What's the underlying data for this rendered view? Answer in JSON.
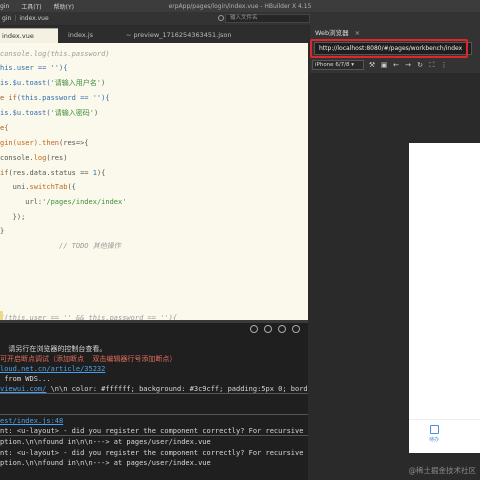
{
  "menubar": {
    "menus": [
      "gin",
      "工具(T)",
      "帮助(Y)"
    ],
    "title": "erpApp/pages/login/index.vue - HBuilder X 4.15"
  },
  "subbar": {
    "project": "gin",
    "file": "index.vue",
    "search_placeholder": "输入文件名"
  },
  "editor_tabs": [
    {
      "label": "index.vue"
    },
    {
      "label": "index.js"
    },
    {
      "label": "~ preview_1716254363451.json"
    }
  ],
  "code_lines": [
    {
      "parts": [
        {
          "t": "console.log(this.password)",
          "c": "c-comment"
        }
      ]
    },
    {
      "parts": [
        {
          "t": "his.user == ''){",
          "c": "c-var"
        }
      ]
    },
    {
      "parts": [
        {
          "t": "is.$u.toast(",
          "c": "c-var"
        },
        {
          "t": "'请输入用户名'",
          "c": "c-str"
        },
        {
          "t": ")",
          "c": "c-op"
        }
      ]
    },
    {
      "parts": [
        {
          "t": "e if",
          "c": "c-kw"
        },
        {
          "t": "(this.password == ''){",
          "c": "c-var"
        }
      ]
    },
    {
      "parts": [
        {
          "t": "is.$u.toast(",
          "c": "c-var"
        },
        {
          "t": "'请输入密码'",
          "c": "c-str"
        },
        {
          "t": ")",
          "c": "c-op"
        }
      ]
    },
    {
      "parts": [
        {
          "t": "e{",
          "c": "c-kw"
        }
      ]
    },
    {
      "parts": [
        {
          "t": "gin(user).",
          "c": "c-fn"
        },
        {
          "t": "then",
          "c": "c-fn"
        },
        {
          "t": "(res=>{",
          "c": "c-op"
        }
      ]
    },
    {
      "parts": [
        {
          "t": "console.",
          "c": "c-op"
        },
        {
          "t": "log",
          "c": "c-fn"
        },
        {
          "t": "(res)",
          "c": "c-op"
        }
      ]
    },
    {
      "parts": [
        {
          "t": "if",
          "c": "c-kw"
        },
        {
          "t": "(res.data.status == ",
          "c": "c-op"
        },
        {
          "t": "1",
          "c": "c-var"
        },
        {
          "t": "){",
          "c": "c-op"
        }
      ]
    },
    {
      "parts": [
        {
          "t": "   uni.",
          "c": "c-op"
        },
        {
          "t": "switchTab",
          "c": "c-fn"
        },
        {
          "t": "({",
          "c": "c-op"
        }
      ]
    },
    {
      "parts": [
        {
          "t": "      url:",
          "c": "c-op"
        },
        {
          "t": "'/pages/index/index'",
          "c": "c-str"
        }
      ]
    },
    {
      "parts": [
        {
          "t": "   });",
          "c": "c-op"
        }
      ]
    },
    {
      "parts": [
        {
          "t": "}",
          "c": "c-op"
        }
      ]
    },
    {
      "parts": [
        {
          "t": "              // TODO 其他操作",
          "c": "c-comment"
        }
      ]
    },
    {
      "parts": [
        {
          "t": "",
          "c": "c-op"
        }
      ]
    },
    {
      "parts": [
        {
          "t": "",
          "c": "c-op"
        }
      ]
    },
    {
      "parts": [
        {
          "t": "",
          "c": "c-op"
        }
      ]
    },
    {
      "parts": [
        {
          "t": "/",
          "c": "c-comment"
        },
        {
          "t": "(this.user == '' && this.password == ''){",
          "c": "c-comment"
        }
      ]
    }
  ],
  "console_lines": [
    {
      "parts": [
        {
          "t": "  请另行在浏览器的控制台查看。",
          "c": ""
        }
      ]
    },
    {
      "parts": [
        {
          "t": "可开启断点调试（添加断点  双击编辑器行号添加断点）",
          "c": "c-red"
        }
      ]
    },
    {
      "parts": [
        {
          "t": "loud.net.cn/article/35232",
          "c": "c-link"
        }
      ]
    },
    {
      "parts": [
        {
          "t": " from WDS...",
          "c": ""
        }
      ]
    },
    {
      "parts": [
        {
          "t": "viewui.com/",
          "c": "c-link"
        },
        {
          "t": " \\n\\n color: #ffffff; background: #3c9cff; padding:5px 0; bord",
          "c": ""
        }
      ]
    },
    {
      "parts": [
        {
          "t": "",
          "c": ""
        }
      ]
    },
    {
      "parts": [
        {
          "t": "",
          "c": ""
        }
      ]
    },
    {
      "parts": [
        {
          "t": "est/index.js:48",
          "c": "c-link"
        }
      ]
    },
    {
      "parts": [
        {
          "t": "nt: <u-layout> - did you register the component correctly? For recursive",
          "c": ""
        }
      ]
    },
    {
      "parts": [
        {
          "t": "ption.\\n\\nfound in\\n\\n---> at pages/user/index.vue",
          "c": ""
        }
      ]
    },
    {
      "parts": [
        {
          "t": "nt: <u-layout> - did you register the component correctly? For recursive",
          "c": ""
        }
      ]
    },
    {
      "parts": [
        {
          "t": "ption.\\n\\nfound in\\n\\n---> at pages/user/index.vue",
          "c": ""
        }
      ]
    }
  ],
  "browser": {
    "tab_label": "Web浏览器",
    "tab_close": "×",
    "url": "http://localhost:8080/#/pages/workbench/index",
    "device": "iPhone 6/7/8 ▾",
    "toolbar_icons": [
      "devtools-icon",
      "save-icon",
      "back-icon",
      "forward-icon",
      "refresh-icon",
      "screenshot-icon",
      "settings-icon"
    ],
    "tabbar_label": "待办"
  },
  "watermark": "@稀土掘金技术社区",
  "colors": {
    "editor_bg": "#fbf9ec",
    "console_bg": "#1f1f1f",
    "highlight": "#e0262a",
    "accent": "#4a90e2"
  }
}
